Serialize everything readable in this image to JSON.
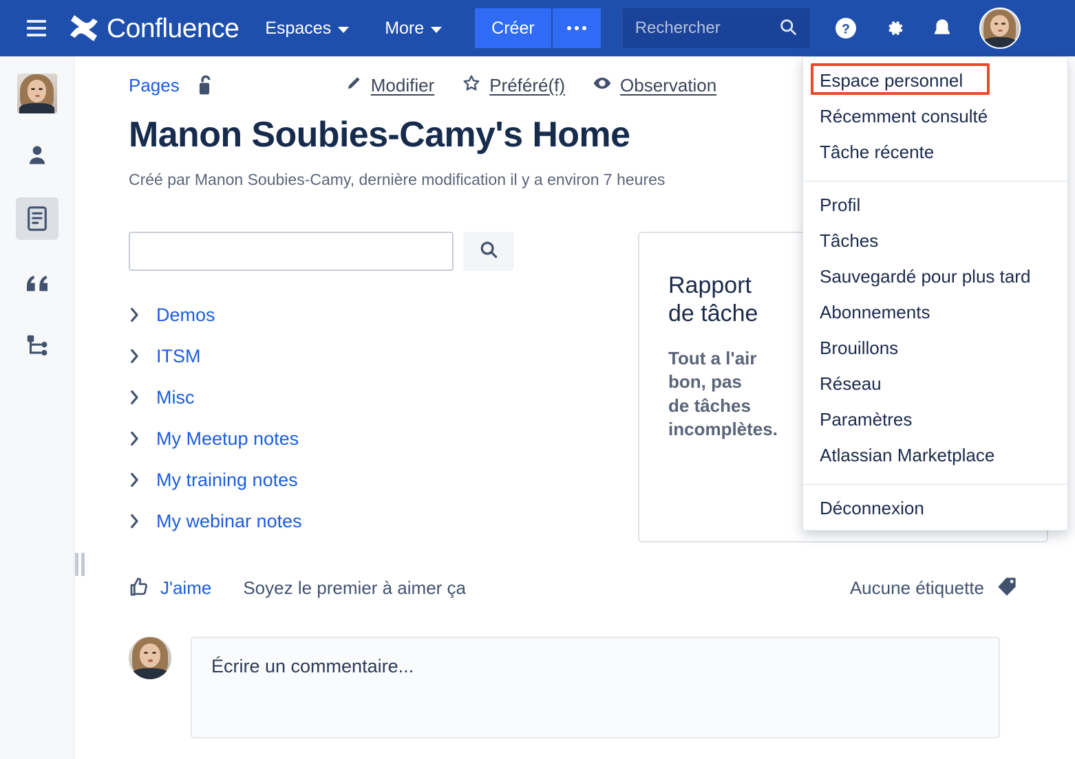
{
  "topnav": {
    "hamburger": "menu-icon",
    "brand": "Confluence",
    "nav_items": [
      {
        "label": "Espaces",
        "has_caret": true
      },
      {
        "label": "More",
        "has_caret": true
      }
    ],
    "create_label": "Créer",
    "create_more_label": "•••",
    "search_placeholder": "Rechercher",
    "icons": [
      "help-icon",
      "gear-icon",
      "notification-icon"
    ],
    "avatar_alt": "Manon Soubies-Camy"
  },
  "leftrail": {
    "items": [
      {
        "name": "space-avatar",
        "label": ""
      },
      {
        "name": "people-icon",
        "label": ""
      },
      {
        "name": "pages-icon",
        "label": "",
        "active": true
      },
      {
        "name": "blog-icon",
        "label": ""
      },
      {
        "name": "space-tree-icon",
        "label": ""
      }
    ]
  },
  "page": {
    "breadcrumb": "Pages",
    "lock_icon": "unlocked-padlock-icon",
    "actions": [
      {
        "icon": "pencil-icon",
        "label": "Modifier"
      },
      {
        "icon": "star-icon",
        "label": "Préféré(f)"
      },
      {
        "icon": "eye-icon",
        "label": "Observation"
      }
    ],
    "title": "Manon Soubies-Camy's Home",
    "meta": "Créé par Manon Soubies-Camy, dernière modification il y a environ 7 heures"
  },
  "tree": {
    "search_value": "",
    "search_placeholder": "",
    "search_button_icon": "search-icon",
    "items": [
      "Demos",
      "ITSM",
      "Misc",
      "My Meetup notes",
      "My training notes",
      "My webinar notes"
    ]
  },
  "report_card": {
    "title": "Rapport de tâche",
    "message": "Tout a l'air bon, pas de tâches incomplètes."
  },
  "footer": {
    "like_icon": "thumbs-up-icon",
    "like_label": "J'aime",
    "like_note": "Soyez le premier à aimer ça",
    "labels_text": "Aucune étiquette",
    "labels_icon": "tag-icon"
  },
  "comment": {
    "placeholder": "Écrire un commentaire..."
  },
  "profile_menu": {
    "group1": [
      "Espace personnel",
      "Récemment consulté",
      "Tâche récente"
    ],
    "group2": [
      "Profil",
      "Tâches",
      "Sauvegardé pour plus tard",
      "Abonnements",
      "Brouillons",
      "Réseau",
      "Paramètres",
      "Atlassian Marketplace"
    ],
    "group3": [
      "Déconnexion"
    ],
    "highlighted_item": "Espace personnel"
  },
  "colors": {
    "nav_blue": "#1f4fad",
    "create_blue": "#2f6bf5",
    "link_blue": "#1b5ce0",
    "text_dark": "#172B4D",
    "highlight_red": "#e8492b"
  }
}
